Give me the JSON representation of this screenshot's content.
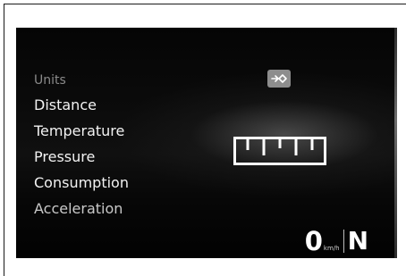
{
  "menu": {
    "header": "Units",
    "items": [
      {
        "label": "Distance"
      },
      {
        "label": "Temperature"
      },
      {
        "label": "Pressure"
      },
      {
        "label": "Consumption"
      },
      {
        "label": "Acceleration"
      }
    ]
  },
  "icons": {
    "enter": "enter-arrow-icon",
    "units": "ruler-icon"
  },
  "status": {
    "speed_value": "0",
    "speed_unit": "km/h",
    "gear": "N"
  },
  "colors": {
    "screen_background": "#050505",
    "text_primary": "#f2f2f2",
    "text_header": "#8a8a8a",
    "icon_badge": "#8d8d8d"
  }
}
